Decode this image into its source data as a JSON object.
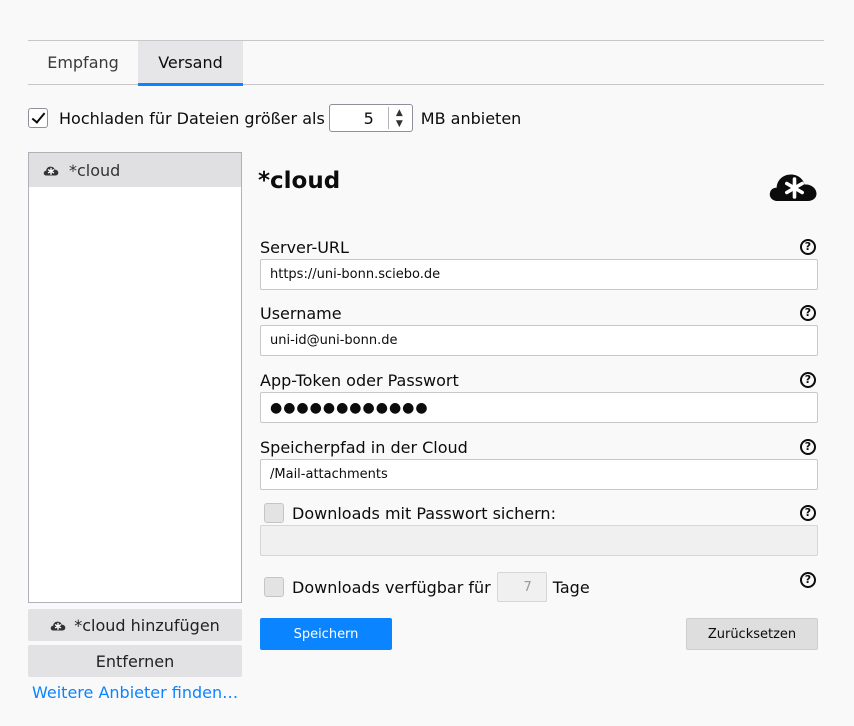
{
  "tabs": [
    {
      "label": "Empfang",
      "active": false
    },
    {
      "label": "Versand",
      "active": true
    }
  ],
  "upload": {
    "checked": true,
    "label": "Hochladen für Dateien größer als",
    "value": "5",
    "unit": "MB anbieten"
  },
  "providers": {
    "items": [
      {
        "label": "*cloud",
        "icon": "cloud-asterisk-icon",
        "selected": true
      }
    ],
    "add_label": "*cloud hinzufügen",
    "remove_label": "Entfernen",
    "find_link": "Weitere Anbieter finden…"
  },
  "detail": {
    "title": "*cloud",
    "fields": {
      "server_url": {
        "label": "Server-URL",
        "value": "https://uni-bonn.sciebo.de"
      },
      "username": {
        "label": "Username",
        "value": "uni-id@uni-bonn.de"
      },
      "token": {
        "label": "App-Token oder Passwort",
        "value": "●●●●●●●●●●●●"
      },
      "path": {
        "label": "Speicherpfad in der Cloud",
        "value": "/Mail-attachments"
      }
    },
    "protect": {
      "label": "Downloads mit Passwort sichern:",
      "checked": false,
      "value": ""
    },
    "expiry": {
      "label": "Downloads verfügbar für",
      "value": "7",
      "unit": "Tage",
      "checked": false
    },
    "help_glyph": "?",
    "save_label": "Speichern",
    "reset_label": "Zurücksetzen"
  },
  "colors": {
    "accent": "#0a84ff",
    "background": "#f9f9fa"
  }
}
